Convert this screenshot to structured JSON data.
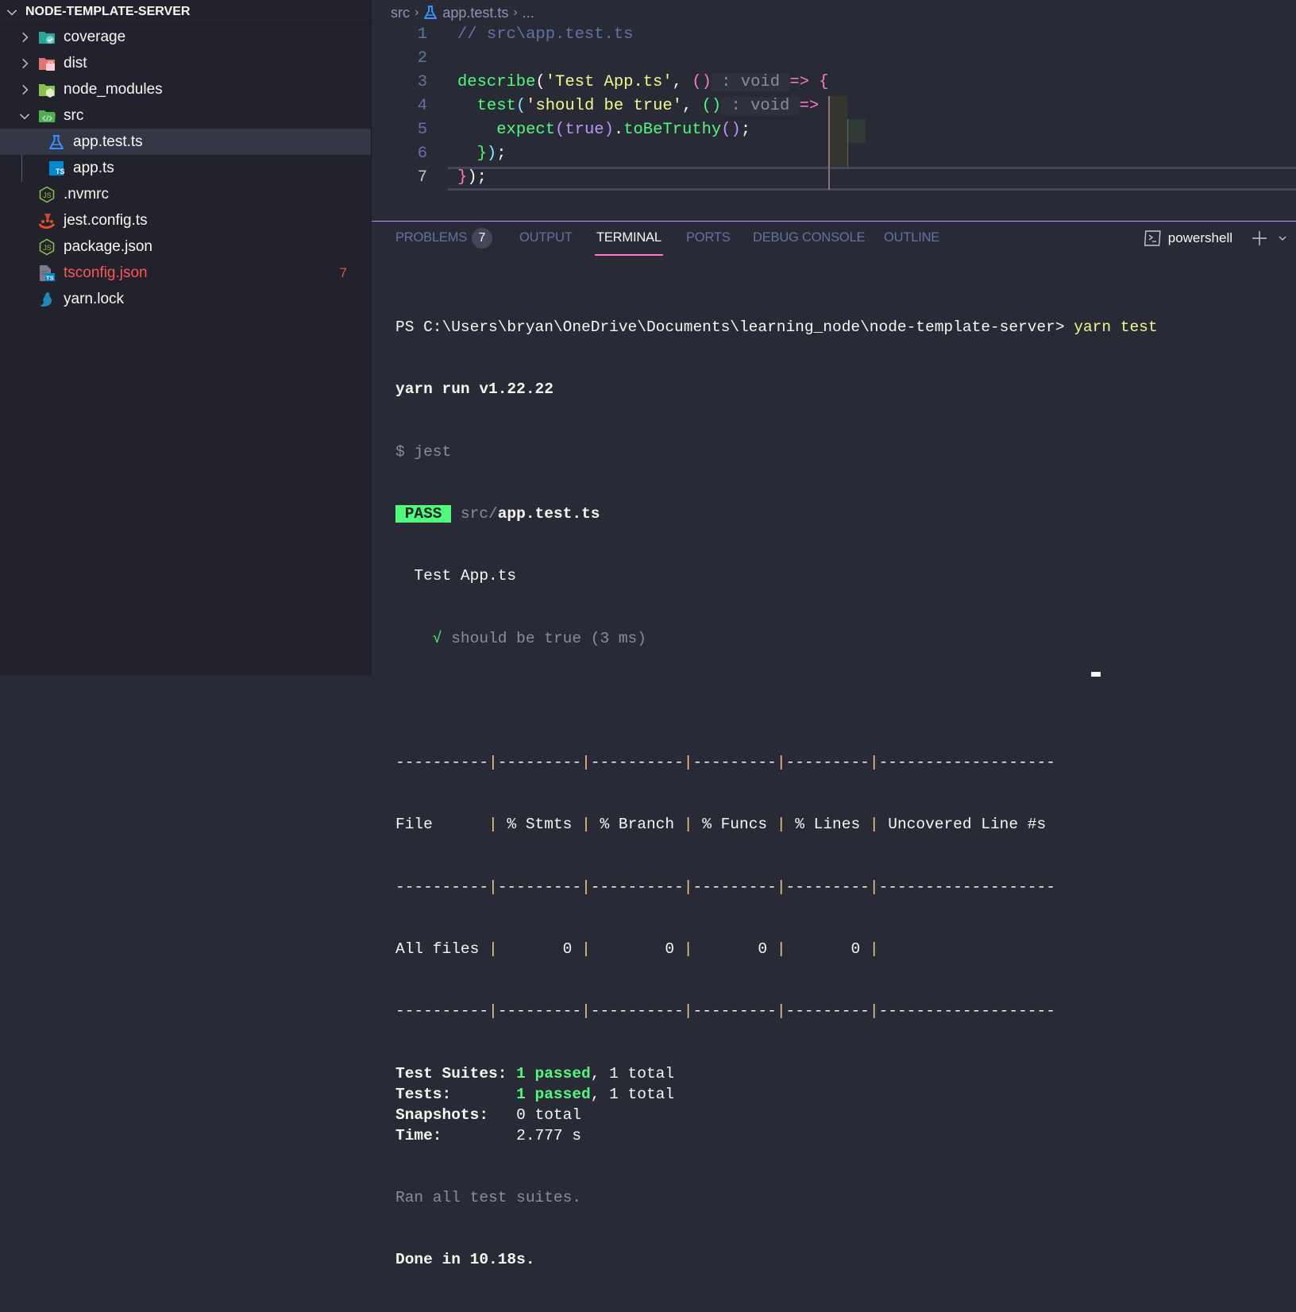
{
  "explorer": {
    "root_label": "NODE-TEMPLATE-SERVER",
    "items": [
      {
        "label": "coverage",
        "type": "folder",
        "icon": "folder-coverage-icon",
        "expanded": false,
        "depth": 0
      },
      {
        "label": "dist",
        "type": "folder",
        "icon": "folder-dist-icon",
        "expanded": false,
        "depth": 0
      },
      {
        "label": "node_modules",
        "type": "folder",
        "icon": "folder-node-icon",
        "expanded": false,
        "depth": 0
      },
      {
        "label": "src",
        "type": "folder",
        "icon": "folder-src-icon",
        "expanded": true,
        "depth": 0
      },
      {
        "label": "app.test.ts",
        "type": "file",
        "icon": "test-flask-icon",
        "depth": 1,
        "selected": true
      },
      {
        "label": "app.ts",
        "type": "file",
        "icon": "typescript-icon",
        "depth": 1
      },
      {
        "label": ".nvmrc",
        "type": "file",
        "icon": "nodejs-icon",
        "depth": 0
      },
      {
        "label": "jest.config.ts",
        "type": "file",
        "icon": "jest-icon",
        "depth": 0
      },
      {
        "label": "package.json",
        "type": "file",
        "icon": "nodejs-icon",
        "depth": 0
      },
      {
        "label": "tsconfig.json",
        "type": "file",
        "icon": "tsconfig-icon",
        "depth": 0,
        "error": true,
        "problems": "7"
      },
      {
        "label": "yarn.lock",
        "type": "file",
        "icon": "yarn-icon",
        "depth": 0
      }
    ]
  },
  "editor": {
    "breadcrumb": [
      "src",
      "app.test.ts",
      "..."
    ],
    "active_line": 7,
    "lines": [
      {
        "n": "1",
        "tokens": [
          {
            "t": "// src\\app.test.ts",
            "c": "c-comment"
          }
        ]
      },
      {
        "n": "2",
        "tokens": []
      },
      {
        "n": "3",
        "tokens": [
          {
            "t": "describe",
            "c": "c-fn"
          },
          {
            "t": "(",
            "c": "c-white"
          },
          {
            "t": "'Test App.ts'",
            "c": "c-str"
          },
          {
            "t": ", ",
            "c": "c-white"
          },
          {
            "t": "()",
            "c": "c-pink"
          },
          {
            "t": " : void ",
            "c": "c-hint"
          },
          {
            "t": "=>",
            "c": "c-pink"
          },
          {
            "t": " ",
            "c": "c-white"
          },
          {
            "t": "{",
            "c": "c-pink"
          }
        ]
      },
      {
        "n": "4",
        "tokens": [
          {
            "t": "  ",
            "c": "c-white"
          },
          {
            "t": "test",
            "c": "c-fn"
          },
          {
            "t": "(",
            "c": "c-blue"
          },
          {
            "t": "'should be true'",
            "c": "c-str"
          },
          {
            "t": ", ",
            "c": "c-white"
          },
          {
            "t": "()",
            "c": "c-green"
          },
          {
            "t": " : void ",
            "c": "c-hint"
          },
          {
            "t": "=>",
            "c": "c-pink"
          },
          {
            "t": " ",
            "c": "c-white"
          },
          {
            "t": "{",
            "c": "c-green"
          }
        ]
      },
      {
        "n": "5",
        "tokens": [
          {
            "t": "    ",
            "c": "c-white"
          },
          {
            "t": "expect",
            "c": "c-fn"
          },
          {
            "t": "(",
            "c": "c-purple"
          },
          {
            "t": "true",
            "c": "c-purple"
          },
          {
            "t": ")",
            "c": "c-purple"
          },
          {
            "t": ".",
            "c": "c-white"
          },
          {
            "t": "toBeTruthy",
            "c": "c-fn"
          },
          {
            "t": "()",
            "c": "c-purple"
          },
          {
            "t": ";",
            "c": "c-white"
          }
        ]
      },
      {
        "n": "6",
        "tokens": [
          {
            "t": "  ",
            "c": "c-white"
          },
          {
            "t": "}",
            "c": "c-green"
          },
          {
            "t": ")",
            "c": "c-blue"
          },
          {
            "t": ";",
            "c": "c-white"
          }
        ]
      },
      {
        "n": "7",
        "tokens": [
          {
            "t": "}",
            "c": "c-pink"
          },
          {
            "t": ")",
            "c": "c-white"
          },
          {
            "t": ";",
            "c": "c-white"
          }
        ]
      }
    ]
  },
  "panel": {
    "tabs": [
      {
        "label": "PROBLEMS",
        "badge": "7"
      },
      {
        "label": "OUTPUT"
      },
      {
        "label": "TERMINAL",
        "active": true
      },
      {
        "label": "PORTS"
      },
      {
        "label": "DEBUG CONSOLE"
      },
      {
        "label": "OUTLINE"
      }
    ],
    "terminal_name": "powershell"
  },
  "terminal": {
    "prompt": "PS C:\\Users\\bryan\\OneDrive\\Documents\\learning_node\\node-template-server> ",
    "command": "yarn test",
    "yarn_version_line": "yarn run v1.22.22",
    "jest_line": "$ jest",
    "pass_badge": " PASS ",
    "pass_dir": "src/",
    "pass_file": "app.test.ts",
    "suite_name": "  Test App.ts",
    "test_check": "    √",
    "test_result": " should be true (3 ms)",
    "coverage_table": {
      "separator": [
        "----------",
        "---------",
        "----------",
        "---------",
        "---------",
        "-------------------"
      ],
      "headers": [
        "File      ",
        " % Stmts ",
        " % Branch ",
        " % Funcs ",
        " % Lines ",
        " Uncovered Line #s"
      ],
      "rows": [
        {
          "cells": [
            "All files ",
            "       0 ",
            "        0 ",
            "       0 ",
            "       0 ",
            ""
          ]
        }
      ]
    },
    "summary": [
      {
        "label": "Test Suites: ",
        "passed": "1 passed",
        "rest": ", 1 total"
      },
      {
        "label": "Tests:       ",
        "passed": "1 passed",
        "rest": ", 1 total"
      },
      {
        "label": "Snapshots:   ",
        "passed": "",
        "rest": "0 total"
      },
      {
        "label": "Time:        ",
        "passed": "",
        "rest": "2.777 s"
      }
    ],
    "ran_line": "Ran all test suites.",
    "done_line": "Done in 10.18s."
  }
}
